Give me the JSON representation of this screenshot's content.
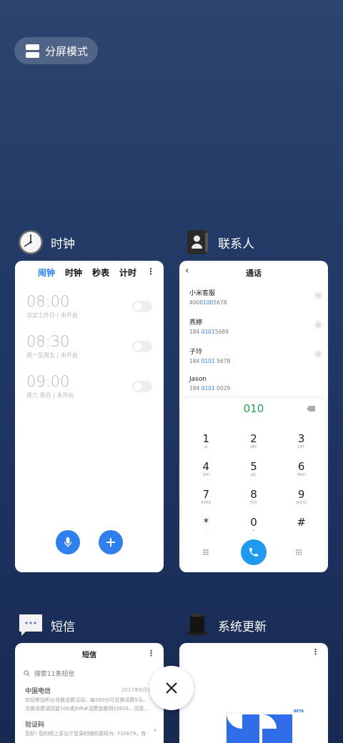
{
  "split_mode": {
    "label": "分屏模式"
  },
  "clock": {
    "app_name": "时钟",
    "tabs": [
      "闹钟",
      "时钟",
      "秒表",
      "计时"
    ],
    "active_tab": "闹钟",
    "alarms": [
      {
        "time": "08:00",
        "desc": "法定工作日 | 未开启"
      },
      {
        "time": "08:30",
        "desc": "周一至周五 | 未开启"
      },
      {
        "time": "09:00",
        "desc": "周六 周日 | 未开启"
      }
    ]
  },
  "contacts": {
    "app_name": "联系人",
    "title": "通话",
    "list": [
      {
        "name": "小米客服",
        "num_pre": "400",
        "num_hl": "0100",
        "num_post": "5678"
      },
      {
        "name": "燕婷",
        "num_pre": "184 ",
        "num_hl": "010",
        "num_post": "15689"
      },
      {
        "name": "子玲",
        "num_pre": "184 ",
        "num_hl": "0101",
        "num_post": " 5678"
      },
      {
        "name": "Jason",
        "num_pre": "184 ",
        "num_hl": "0101",
        "num_post": " 0029"
      }
    ],
    "dial_value": "010",
    "keys": [
      {
        "d": "1",
        "l": "ꝏ"
      },
      {
        "d": "2",
        "l": "ABC"
      },
      {
        "d": "3",
        "l": "DEF"
      },
      {
        "d": "4",
        "l": "GHI"
      },
      {
        "d": "5",
        "l": "JKL"
      },
      {
        "d": "6",
        "l": "MNO"
      },
      {
        "d": "7",
        "l": "PQRS"
      },
      {
        "d": "8",
        "l": "TUV"
      },
      {
        "d": "9",
        "l": "WXYZ"
      },
      {
        "d": "*",
        "l": ","
      },
      {
        "d": "0",
        "l": "+"
      },
      {
        "d": "#",
        "l": ""
      }
    ]
  },
  "sms": {
    "app_name": "短信",
    "title": "短信",
    "search_placeholder": "搜索11条短信",
    "messages": [
      {
        "sender": "中国电信",
        "date": "2017年6月30",
        "preview1": "欢迎参加积分兑换话费活动，每500分可兑换话费5元，",
        "preview2": "兑换话费请回复106或jfdh#话费金额到10001，回复..."
      },
      {
        "sender": "验证码",
        "date": "",
        "preview1": "您好! 您的网上营业厅登录的随机密码为: 710679，有",
        "preview2": ""
      }
    ]
  },
  "update": {
    "app_name": "系统更新",
    "badge": "BETA"
  },
  "colors": {
    "accent": "#2f80ed",
    "dial_green": "#1ea154",
    "call_blue": "#1e9bf0"
  }
}
